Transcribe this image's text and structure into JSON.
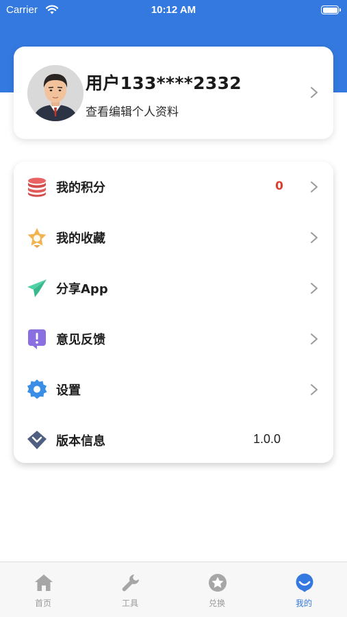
{
  "status_bar": {
    "carrier": "Carrier",
    "time": "10:12 AM"
  },
  "profile": {
    "username": "用户133****2332",
    "subtitle": "查看编辑个人资料"
  },
  "menu": {
    "items": [
      {
        "label": "我的积分",
        "value": "0",
        "icon": "coins-stack-icon",
        "icon_color": "#e05a5a"
      },
      {
        "label": "我的收藏",
        "icon": "star-badge-icon",
        "icon_color": "#f0b24a"
      },
      {
        "label": "分享App",
        "icon": "paper-plane-icon",
        "icon_color": "#3fc79a"
      },
      {
        "label": "意见反馈",
        "icon": "feedback-icon",
        "icon_color": "#8a6fe0"
      },
      {
        "label": "设置",
        "icon": "gear-icon",
        "icon_color": "#3a8ee6"
      },
      {
        "label": "版本信息",
        "value": "1.0.0",
        "icon": "version-diamond-icon",
        "icon_color": "#4f5f82"
      }
    ]
  },
  "tabbar": {
    "tabs": [
      {
        "label": "首页",
        "icon": "home-icon"
      },
      {
        "label": "工具",
        "icon": "wrench-icon"
      },
      {
        "label": "兑换",
        "icon": "exchange-star-icon"
      },
      {
        "label": "我的",
        "icon": "profile-icon",
        "active": true
      }
    ]
  },
  "colors": {
    "brand": "#3479e0",
    "points_value": "#d8402f",
    "tab_inactive": "#9a9a9a"
  }
}
